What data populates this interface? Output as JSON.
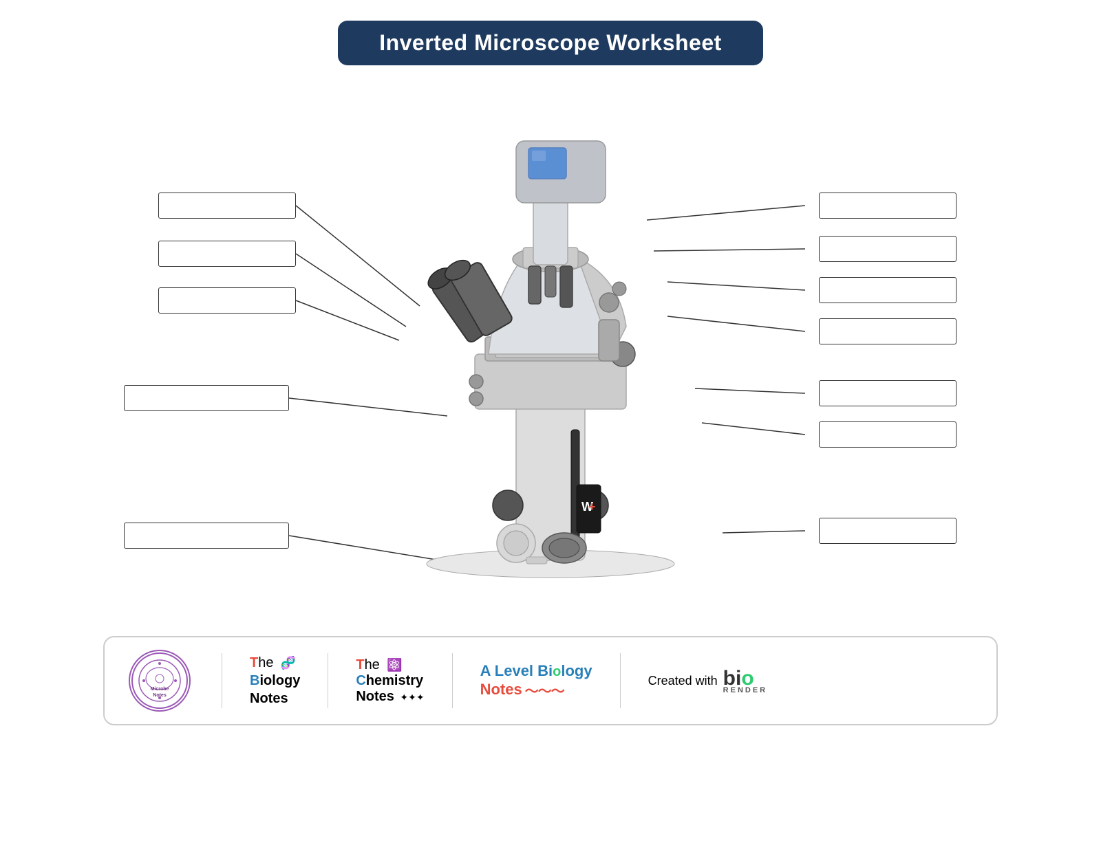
{
  "page": {
    "title": "Inverted Microscope Worksheet",
    "bg_color": "#ffffff"
  },
  "labels": {
    "left": [
      {
        "id": "left-1",
        "text": ""
      },
      {
        "id": "left-2",
        "text": ""
      },
      {
        "id": "left-3",
        "text": ""
      },
      {
        "id": "left-4",
        "text": ""
      },
      {
        "id": "left-5",
        "text": ""
      }
    ],
    "right": [
      {
        "id": "right-1",
        "text": ""
      },
      {
        "id": "right-2",
        "text": ""
      },
      {
        "id": "right-3",
        "text": ""
      },
      {
        "id": "right-4",
        "text": ""
      },
      {
        "id": "right-5",
        "text": ""
      },
      {
        "id": "right-6",
        "text": ""
      },
      {
        "id": "right-7",
        "text": ""
      }
    ]
  },
  "footer": {
    "microbe_notes": "Microbe Notes",
    "biology_notes_t": "T",
    "biology_notes_he": "he",
    "biology_notes_b": "B",
    "biology_notes_iology": "iology",
    "biology_notes_n": "N",
    "biology_notes_otes": "otes",
    "chemistry_t": "T",
    "chemistry_he": "he",
    "chemistry_c": "C",
    "chemistry_hemistry": "hemistry",
    "chemistry_n": "N",
    "chemistry_otes": "otes",
    "alevel_a": "A",
    "alevel_level": " Level ",
    "alevel_bio": "Bi",
    "alevel_o": "o",
    "alevel_logy": "l",
    "alevel_gy": "ogy",
    "alevel_notes": "Notes",
    "created_with": "Created with",
    "bio_render": "bio",
    "render_text": "RENDER"
  }
}
